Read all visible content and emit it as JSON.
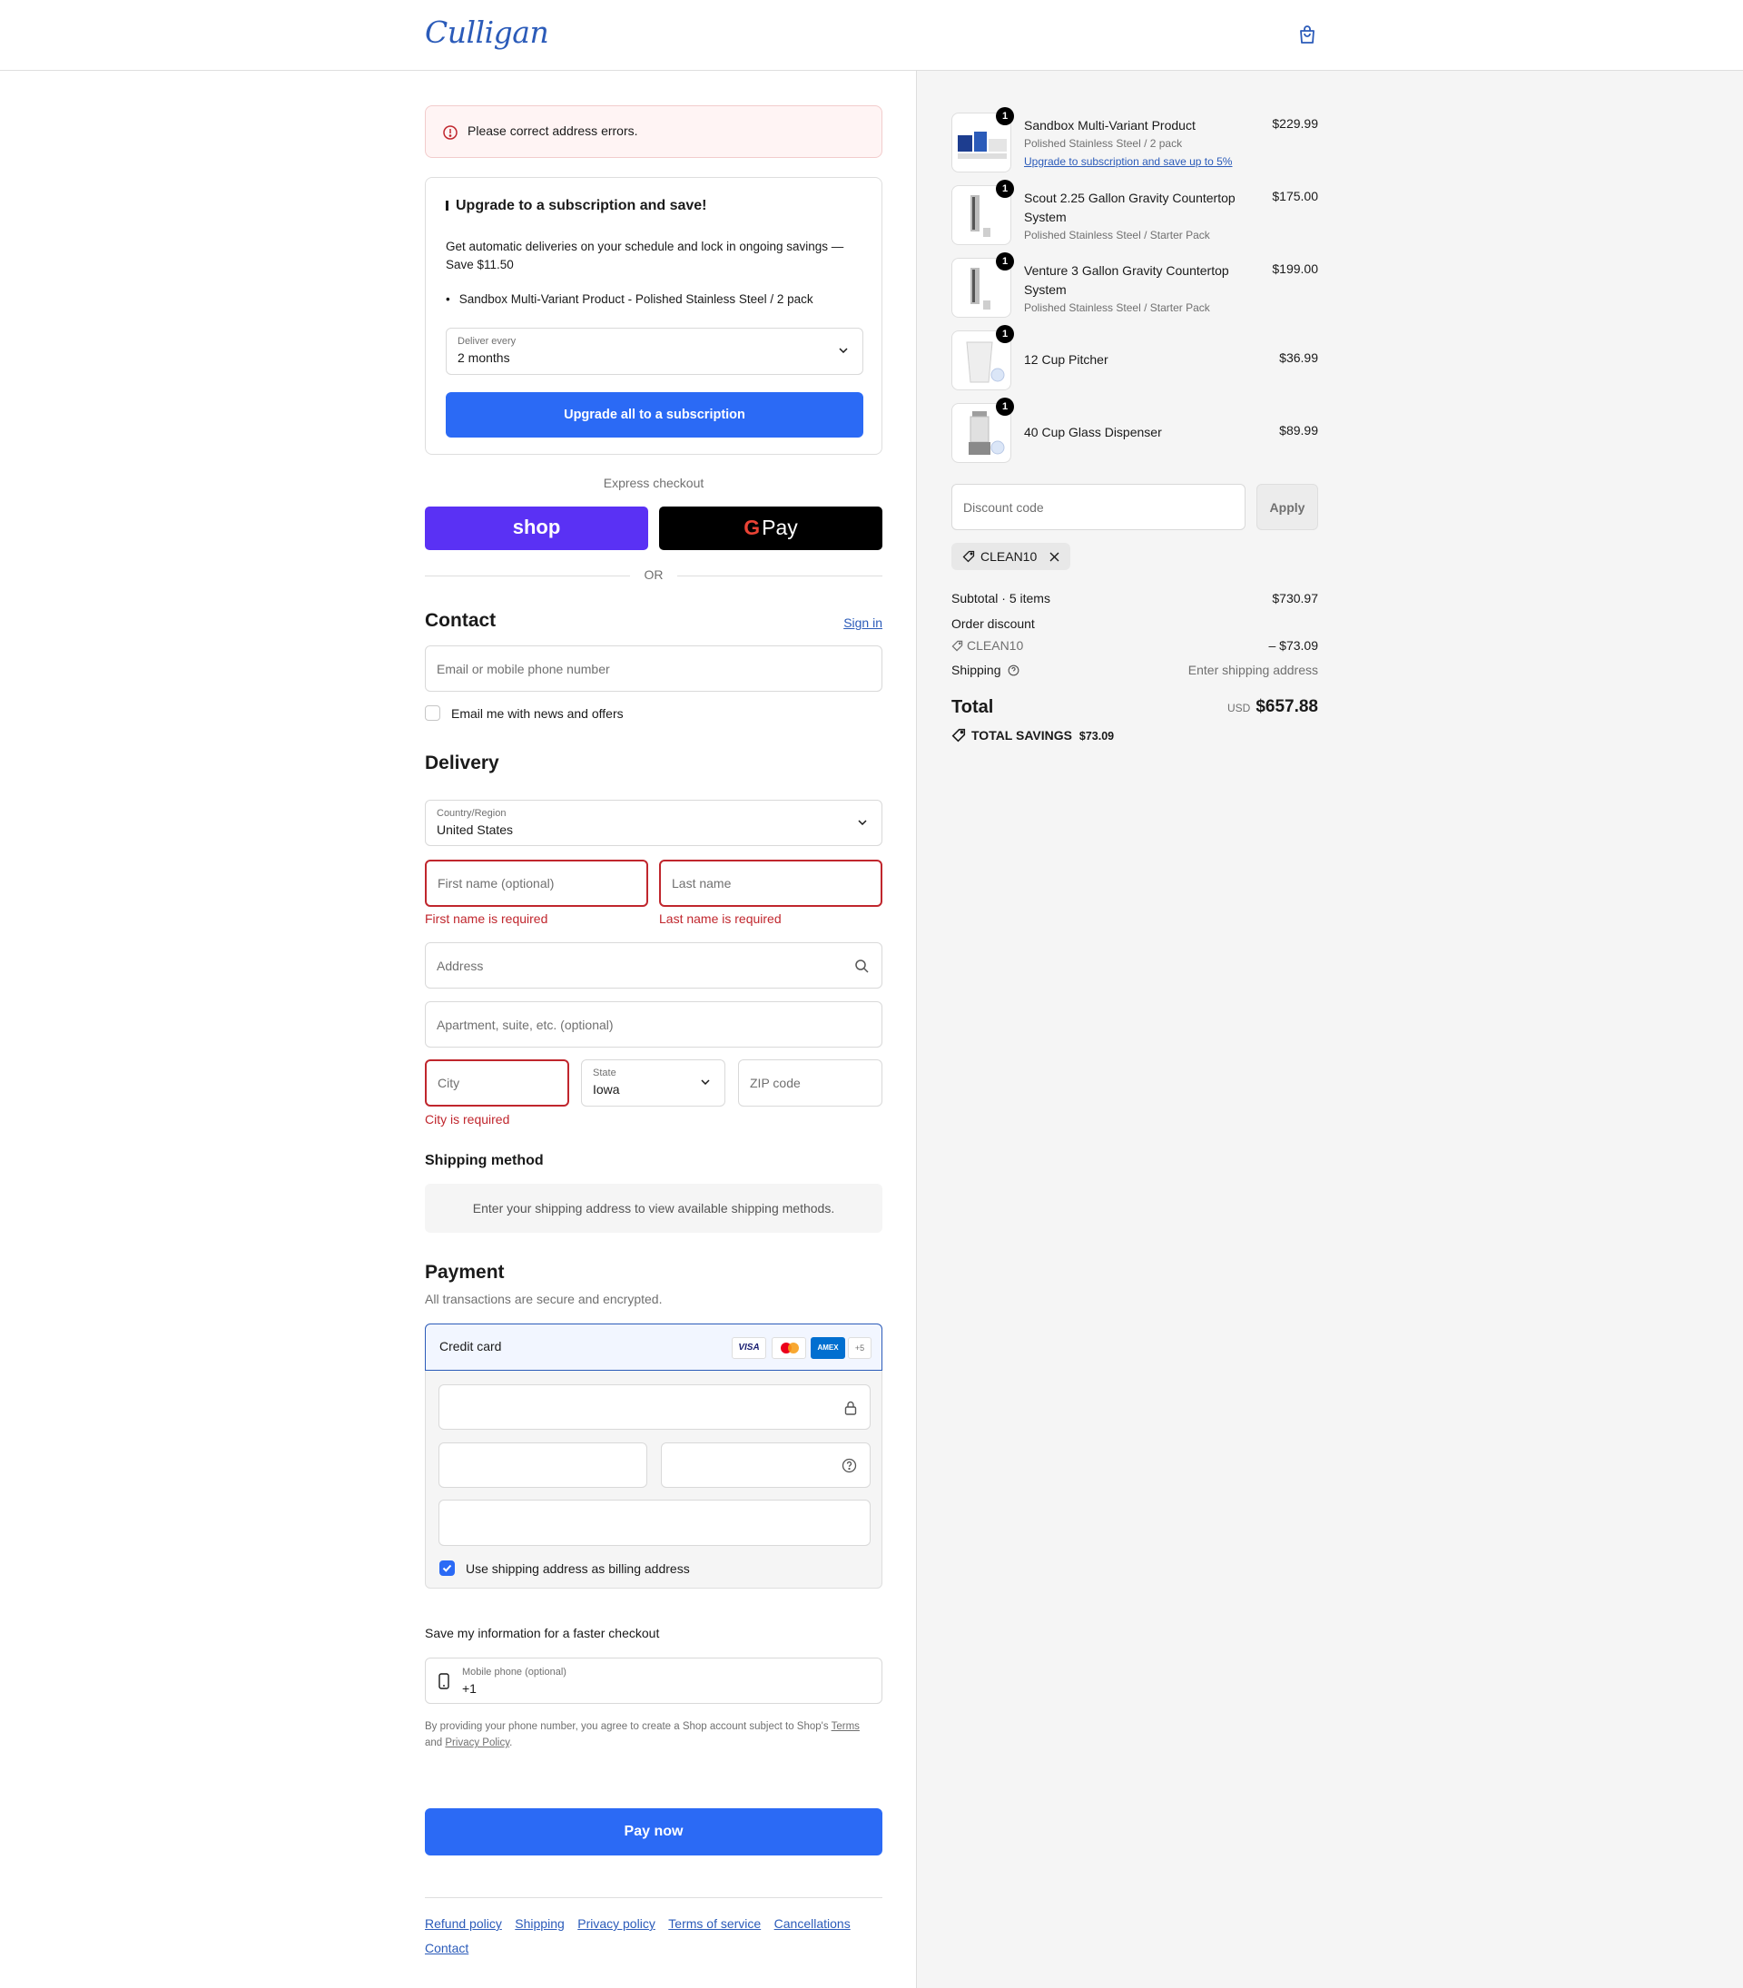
{
  "header": {
    "logo": "Culligan",
    "cart_icon": "shopping-bag-icon"
  },
  "alert": {
    "text": "Please correct address errors."
  },
  "subscription": {
    "title": "Upgrade to a subscription and save!",
    "description": "Get automatic deliveries on your schedule and lock in ongoing savings — Save $11.50",
    "item": "Sandbox Multi-Variant Product - Polished Stainless Steel / 2 pack",
    "deliver_label": "Deliver every",
    "deliver_value": "2 months",
    "button": "Upgrade all to a subscription"
  },
  "express": {
    "label": "Express checkout",
    "shop": "shop",
    "gpay_g": "G",
    "gpay": "Pay",
    "or": "OR"
  },
  "contact": {
    "title": "Contact",
    "sign_in": "Sign in",
    "email_placeholder": "Email or mobile phone number",
    "news_label": "Email me with news and offers"
  },
  "delivery": {
    "title": "Delivery",
    "country_label": "Country/Region",
    "country_value": "United States",
    "first_name_placeholder": "First name (optional)",
    "last_name_placeholder": "Last name",
    "first_name_error": "First name is required",
    "last_name_error": "Last name is required",
    "address_placeholder": "Address",
    "apartment_placeholder": "Apartment, suite, etc. (optional)",
    "city_placeholder": "City",
    "state_label": "State",
    "state_value": "Iowa",
    "zip_placeholder": "ZIP code",
    "city_error": "City is required"
  },
  "shipping_method": {
    "title": "Shipping method",
    "message": "Enter your shipping address to view available shipping methods."
  },
  "payment": {
    "title": "Payment",
    "subtitle": "All transactions are secure and encrypted.",
    "method": "Credit card",
    "card_logos": [
      "VISA",
      "",
      "AMEX",
      "+5"
    ],
    "billing_label": "Use shipping address as billing address"
  },
  "save_info": {
    "title": "Save my information for a faster checkout",
    "phone_label": "Mobile phone (optional)",
    "phone_value": "+1",
    "legal_prefix": "By providing your phone number, you agree to create a Shop account subject to Shop's",
    "terms": "Terms",
    "and": "and",
    "privacy": "Privacy Policy",
    "period": "."
  },
  "pay_button": "Pay now",
  "footer_links": [
    "Refund policy",
    "Shipping",
    "Privacy policy",
    "Terms of service",
    "Cancellations",
    "Contact"
  ],
  "summary": {
    "items": [
      {
        "name": "Sandbox Multi-Variant Product",
        "variant": "Polished Stainless Steel / 2 pack",
        "link": "Upgrade to subscription and save up to 5%",
        "price": "$229.99",
        "qty": "1"
      },
      {
        "name": "Scout 2.25 Gallon Gravity Countertop System",
        "variant": "Polished Stainless Steel / Starter Pack",
        "price": "$175.00",
        "qty": "1"
      },
      {
        "name": "Venture 3 Gallon Gravity Countertop System",
        "variant": "Polished Stainless Steel / Starter Pack",
        "price": "$199.00",
        "qty": "1"
      },
      {
        "name": "12 Cup Pitcher",
        "price": "$36.99",
        "qty": "1"
      },
      {
        "name": "40 Cup Glass Dispenser",
        "price": "$89.99",
        "qty": "1"
      }
    ],
    "discount_placeholder": "Discount code",
    "apply": "Apply",
    "applied_code": "CLEAN10",
    "subtotal_label": "Subtotal · 5 items",
    "subtotal_value": "$730.97",
    "order_discount_label": "Order discount",
    "discount_code": "CLEAN10",
    "discount_value": "– $73.09",
    "shipping_label": "Shipping",
    "shipping_value": "Enter shipping address",
    "total_label": "Total",
    "currency": "USD",
    "total_value": "$657.88",
    "savings_label": "TOTAL SAVINGS",
    "savings_value": "$73.09"
  },
  "colors": {
    "accent": "#2b6af5",
    "error": "#c0262d",
    "shop": "#5a31f4",
    "logo": "#2b5bb9"
  }
}
